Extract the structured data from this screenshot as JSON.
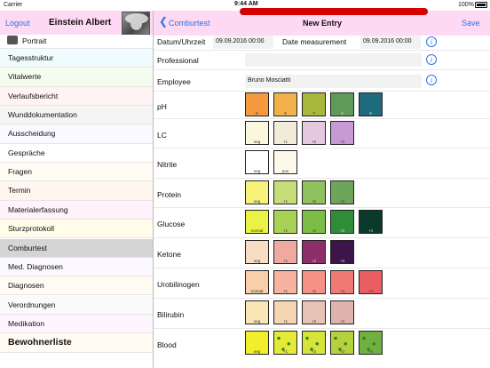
{
  "status_bar": {
    "carrier": "Carrier",
    "time": "9:44 AM",
    "battery": "100%"
  },
  "left_header": {
    "logout_label": "Logout",
    "patient_name": "Einstein Albert"
  },
  "right_header": {
    "back_label": "Comburtest",
    "title": "New Entry",
    "save_label": "Save"
  },
  "sidebar": {
    "portrait_label": "Portrait",
    "items": [
      {
        "label": "Tagesstruktur"
      },
      {
        "label": "Vitalwerte"
      },
      {
        "label": "Verlaufsbericht"
      },
      {
        "label": "Wunddokumentation"
      },
      {
        "label": "Ausscheidung"
      },
      {
        "label": "Gespräche"
      },
      {
        "label": "Fragen"
      },
      {
        "label": "Termin"
      },
      {
        "label": "Materialerfassung"
      },
      {
        "label": "Sturzprotokoll"
      },
      {
        "label": "Comburtest"
      },
      {
        "label": "Med. Diagnosen"
      },
      {
        "label": "Diagnosen"
      },
      {
        "label": "Verordnungen"
      },
      {
        "label": "Medikation"
      },
      {
        "label": "Bewohnerliste"
      }
    ],
    "row_colors": [
      "#ffffff",
      "#f0fbfd",
      "#f3fcef",
      "#fff3f4",
      "#f5f5f5",
      "#f9f9ff",
      "#ffffff",
      "#fefbf2",
      "#fff6f0",
      "#fff2fa",
      "#fffcea",
      "#d4d4d4",
      "#fbf8ff",
      "#fffaf2",
      "#fafafa",
      "#fff5ff",
      "#fffaf2"
    ],
    "selected": "Comburtest"
  },
  "form": {
    "datum_label": "Datum/Uhrzeit",
    "datum_value": "09.09.2016 00:00",
    "measurement_label": "Date measurement",
    "measurement_value": "09.09.2016 00:00",
    "professional_label": "Professional",
    "professional_value": "",
    "employee_label": "Employee",
    "employee_value": "Bruno Mosciatti",
    "info_icon": "i"
  },
  "tests": [
    {
      "label": "pH",
      "swatches": [
        {
          "color": "#f59a3e",
          "text": "5"
        },
        {
          "color": "#f3b14a",
          "text": "6"
        },
        {
          "color": "#a7b83c",
          "text": "7"
        },
        {
          "color": "#5f9a5a",
          "text": "8"
        },
        {
          "color": "#1f6b7e",
          "text": "9"
        }
      ]
    },
    {
      "label": "LC",
      "swatches": [
        {
          "color": "#fbf7df",
          "text": "neg"
        },
        {
          "color": "#f1ecd9",
          "text": "+1"
        },
        {
          "color": "#e4c8e0",
          "text": "+2"
        },
        {
          "color": "#c79ad6",
          "text": "+3"
        }
      ]
    },
    {
      "label": "Nitrite",
      "swatches": [
        {
          "color": "#ffffff",
          "text": "neg"
        },
        {
          "color": "#fdf9ea",
          "text": "pos"
        }
      ]
    },
    {
      "label": "Protein",
      "swatches": [
        {
          "color": "#f7f37a",
          "text": "neg"
        },
        {
          "color": "#c5de78",
          "text": "+1"
        },
        {
          "color": "#8fc15f",
          "text": "+2"
        },
        {
          "color": "#6ea55a",
          "text": "+3"
        }
      ]
    },
    {
      "label": "Glucose",
      "swatches": [
        {
          "color": "#eaf243",
          "text": "normal"
        },
        {
          "color": "#a8d255",
          "text": "+1"
        },
        {
          "color": "#7bbd47",
          "text": "+2"
        },
        {
          "color": "#2f8d3a",
          "text": "+3"
        },
        {
          "color": "#0a3a2c",
          "text": "+4"
        }
      ]
    },
    {
      "label": "Ketone",
      "swatches": [
        {
          "color": "#f8dcc4",
          "text": "neg"
        },
        {
          "color": "#f0a9a1",
          "text": "+1"
        },
        {
          "color": "#8c2e6a",
          "text": "+2"
        },
        {
          "color": "#3d1548",
          "text": "+3"
        }
      ]
    },
    {
      "label": "Urobilinogen",
      "swatches": [
        {
          "color": "#f9cfa9",
          "text": "normal"
        },
        {
          "color": "#f7b2a0",
          "text": "+1"
        },
        {
          "color": "#f49288",
          "text": "+2"
        },
        {
          "color": "#ef7a75",
          "text": "+3"
        },
        {
          "color": "#ea5e63",
          "text": "+4"
        }
      ]
    },
    {
      "label": "Bilirubin",
      "swatches": [
        {
          "color": "#f9e6b6",
          "text": "neg"
        },
        {
          "color": "#f4d6b4",
          "text": "+1"
        },
        {
          "color": "#e9c4b6",
          "text": "+2"
        },
        {
          "color": "#dfb4ae",
          "text": "+3"
        }
      ]
    },
    {
      "label": "Blood",
      "swatches": [
        {
          "color": "#f2ee2a",
          "text": "neg",
          "speck": false
        },
        {
          "color": "#e4ea35",
          "text": "+1",
          "speck": true
        },
        {
          "color": "#d5e33a",
          "text": "+2",
          "speck": true
        },
        {
          "color": "#b5d23c",
          "text": "+3",
          "speck": true
        },
        {
          "color": "#6fb040",
          "text": "+4",
          "speck": true
        }
      ]
    }
  ]
}
